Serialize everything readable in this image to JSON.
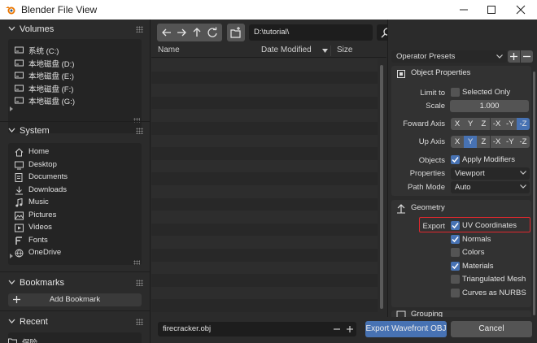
{
  "window": {
    "title": "Blender File View"
  },
  "sidebar": {
    "volumes": {
      "header": "Volumes",
      "items": [
        {
          "label": "系统 (C:)",
          "icon": "drive-icon"
        },
        {
          "label": "本地磁盘 (D:)",
          "icon": "drive-icon"
        },
        {
          "label": "本地磁盘 (E:)",
          "icon": "drive-icon"
        },
        {
          "label": "本地磁盘 (F:)",
          "icon": "drive-icon"
        },
        {
          "label": "本地磁盘 (G:)",
          "icon": "drive-icon"
        }
      ]
    },
    "system": {
      "header": "System",
      "items": [
        {
          "label": "Home",
          "icon": "home-icon"
        },
        {
          "label": "Desktop",
          "icon": "desktop-icon"
        },
        {
          "label": "Documents",
          "icon": "documents-icon"
        },
        {
          "label": "Downloads",
          "icon": "downloads-icon"
        },
        {
          "label": "Music",
          "icon": "music-icon"
        },
        {
          "label": "Pictures",
          "icon": "pictures-icon"
        },
        {
          "label": "Videos",
          "icon": "videos-icon"
        },
        {
          "label": "Fonts",
          "icon": "fonts-icon"
        },
        {
          "label": "OneDrive",
          "icon": "onedrive-icon"
        }
      ]
    },
    "bookmarks": {
      "header": "Bookmarks",
      "add_label": "Add Bookmark"
    },
    "recent": {
      "header": "Recent",
      "items": [
        {
          "label": "保险"
        }
      ]
    }
  },
  "toolbar": {
    "path": "D:\\tutorial\\"
  },
  "file_list": {
    "columns": [
      "Name",
      "Date Modified",
      "Size"
    ]
  },
  "operator": {
    "presets_label": "Operator Presets",
    "object_properties": {
      "header": "Object Properties",
      "limit_to_label": "Limit to",
      "selected_only_label": "Selected Only",
      "selected_only": false,
      "scale_label": "Scale",
      "scale_value": "1.000",
      "forward_axis_label": "Foward Axis",
      "forward_axis_options": [
        "X",
        "Y",
        "Z",
        "-X",
        "-Y",
        "-Z"
      ],
      "forward_axis_selected": "-Z",
      "up_axis_label": "Up Axis",
      "up_axis_options": [
        "X",
        "Y",
        "Z",
        "-X",
        "-Y",
        "-Z"
      ],
      "up_axis_selected": "Y",
      "objects_label": "Objects",
      "apply_modifiers_label": "Apply Modifiers",
      "apply_modifiers": true,
      "properties_label": "Properties",
      "properties_value": "Viewport",
      "path_mode_label": "Path Mode",
      "path_mode_value": "Auto"
    },
    "geometry": {
      "header": "Geometry",
      "export_label": "Export",
      "options": [
        {
          "label": "UV Coordinates",
          "checked": true
        },
        {
          "label": "Normals",
          "checked": true
        },
        {
          "label": "Colors",
          "checked": false
        },
        {
          "label": "Materials",
          "checked": true
        },
        {
          "label": "Triangulated Mesh",
          "checked": false
        },
        {
          "label": "Curves as NURBS",
          "checked": false
        }
      ]
    },
    "grouping": {
      "header": "Grouping"
    },
    "highlight_color": "#e0282e"
  },
  "bottom": {
    "filename": "firecracker.obj",
    "export_label": "Export Wavefront OBJ",
    "cancel_label": "Cancel"
  },
  "colors": {
    "accent": "#4772b3",
    "bg": "#2b2b2b"
  }
}
